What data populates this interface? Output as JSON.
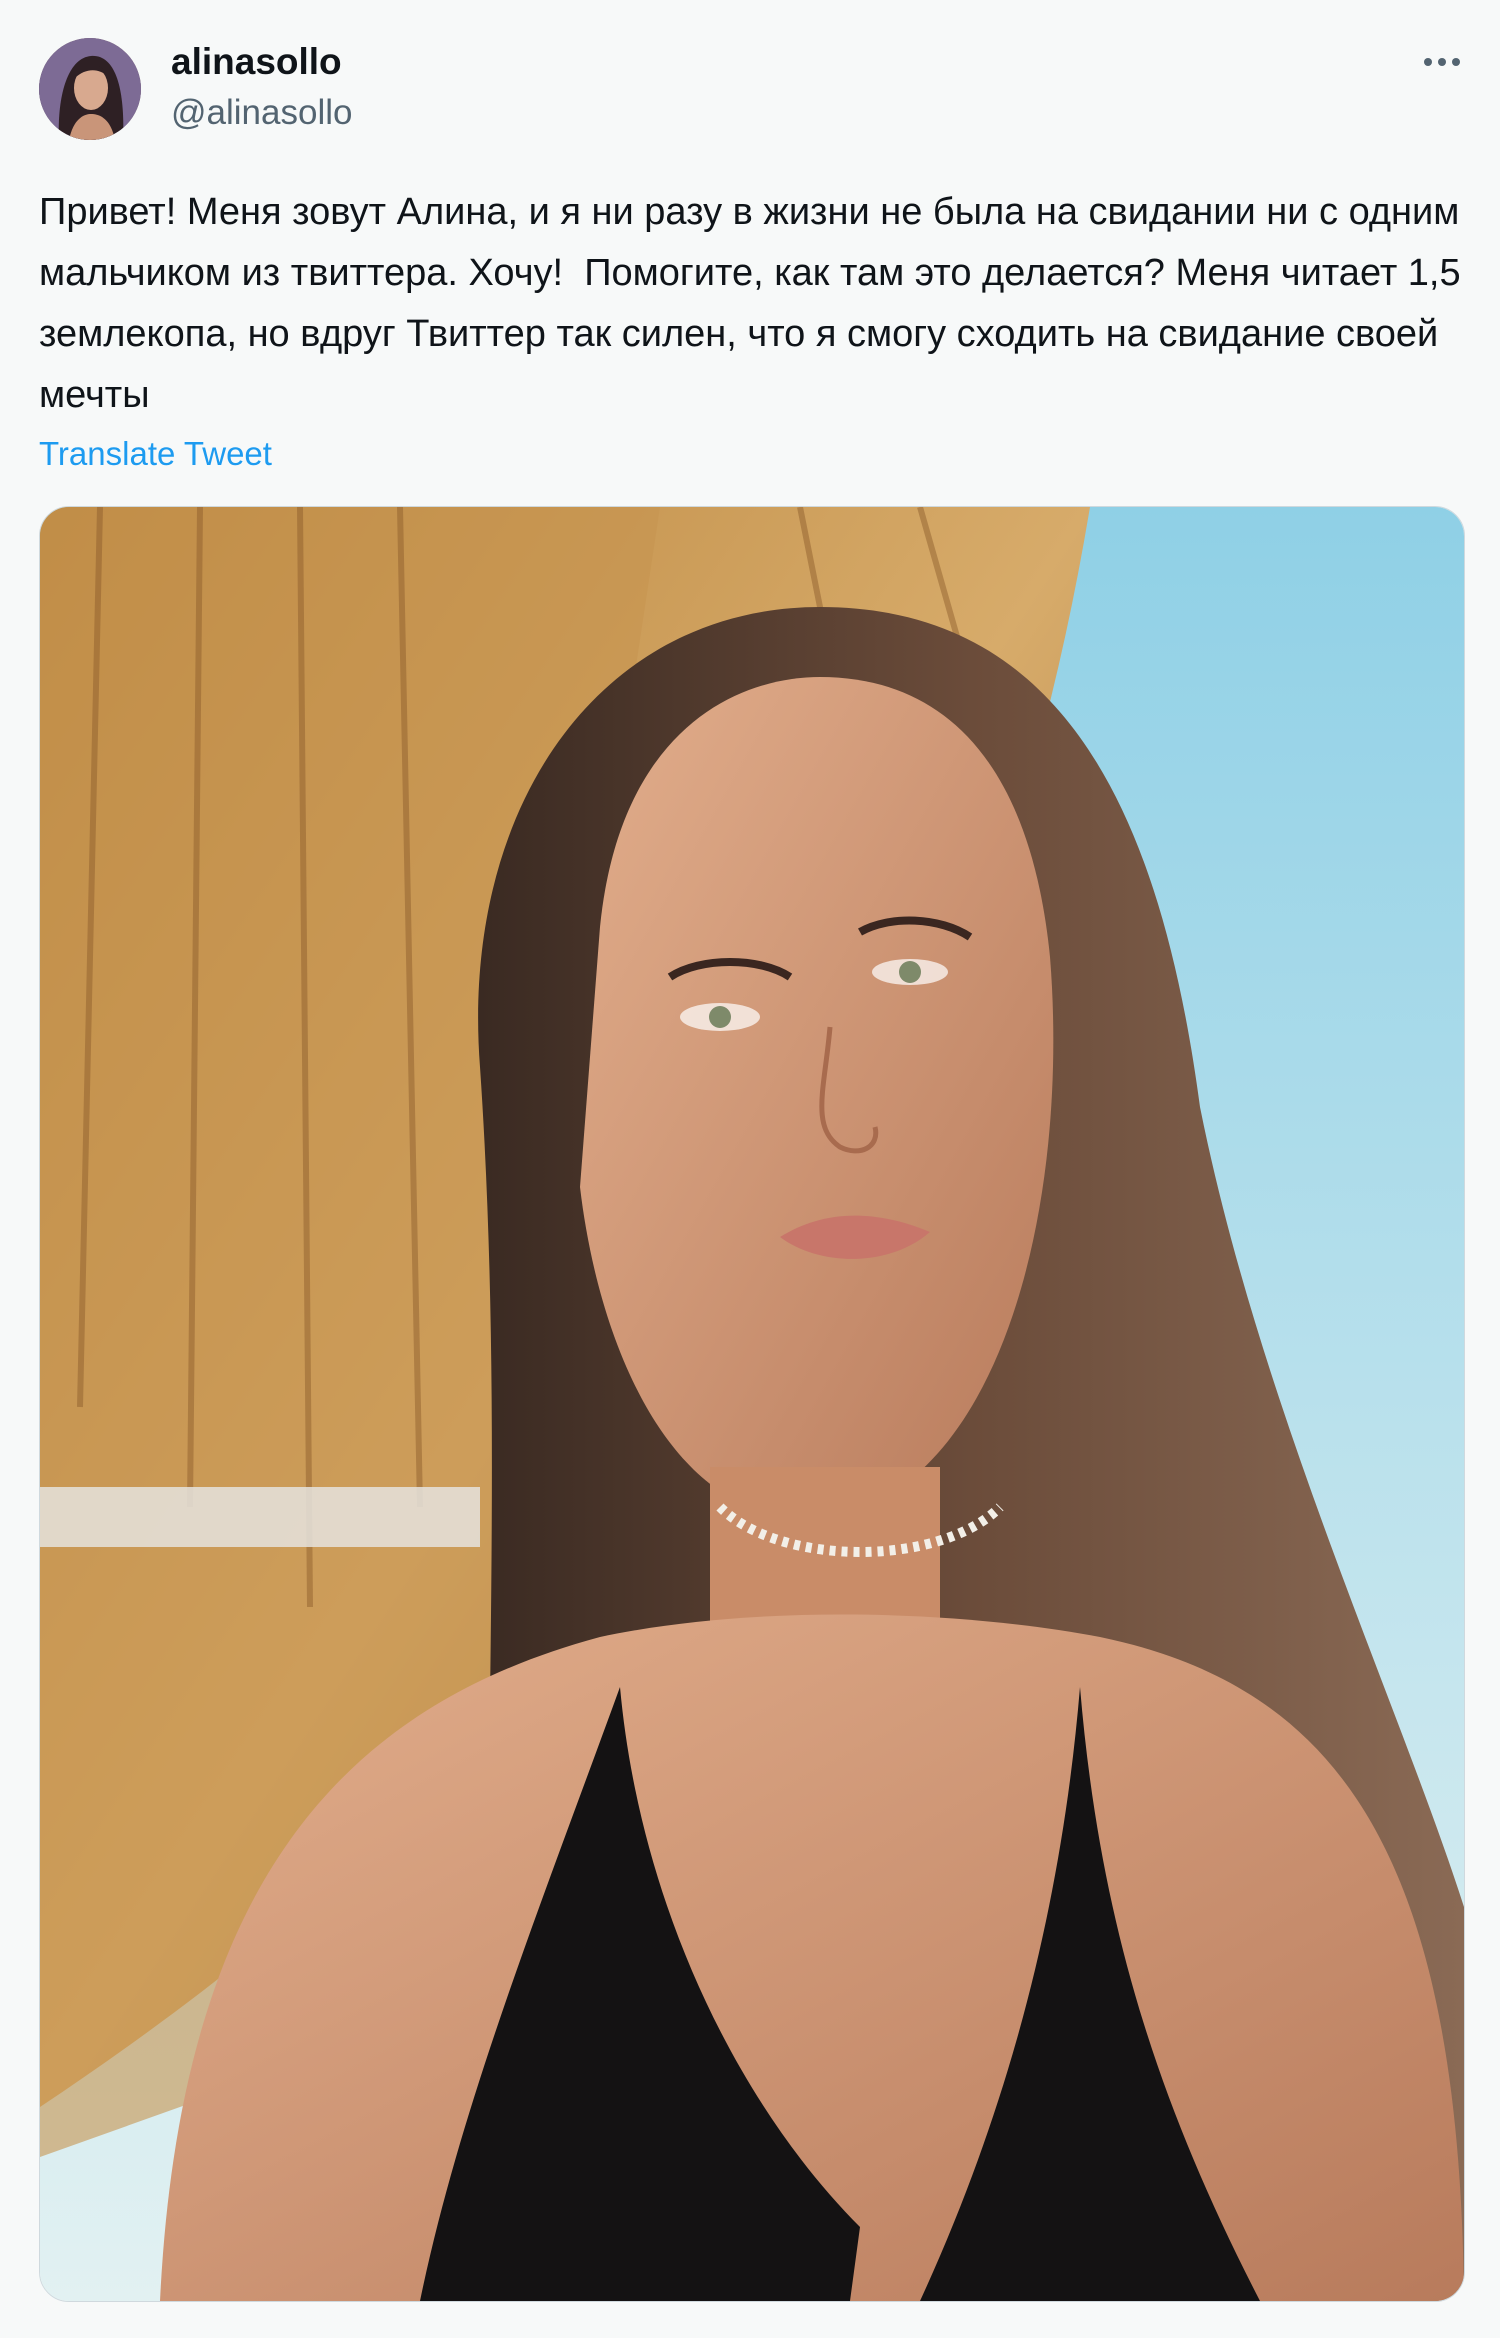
{
  "author": {
    "display_name": "alinasollo",
    "handle": "@alinasollo",
    "avatar_icon": "profile-photo"
  },
  "tweet": {
    "text": "Привет! Меня зовут Алина, и я ни разу в жизни не была на свидании ни с одним мальчиком из твиттера. Хочу!  Помогите, как там это делается? Меня читает 1,5 землекопа, но вдруг Твиттер так силен, что я смогу сходить на свидание своей мечты",
    "translate_label": "Translate Tweet"
  },
  "icons": {
    "more": "more-horizontal-icon"
  },
  "colors": {
    "background": "#f7f9f9",
    "text_primary": "#0f1419",
    "text_secondary": "#536471",
    "link": "#1d9bf0"
  }
}
